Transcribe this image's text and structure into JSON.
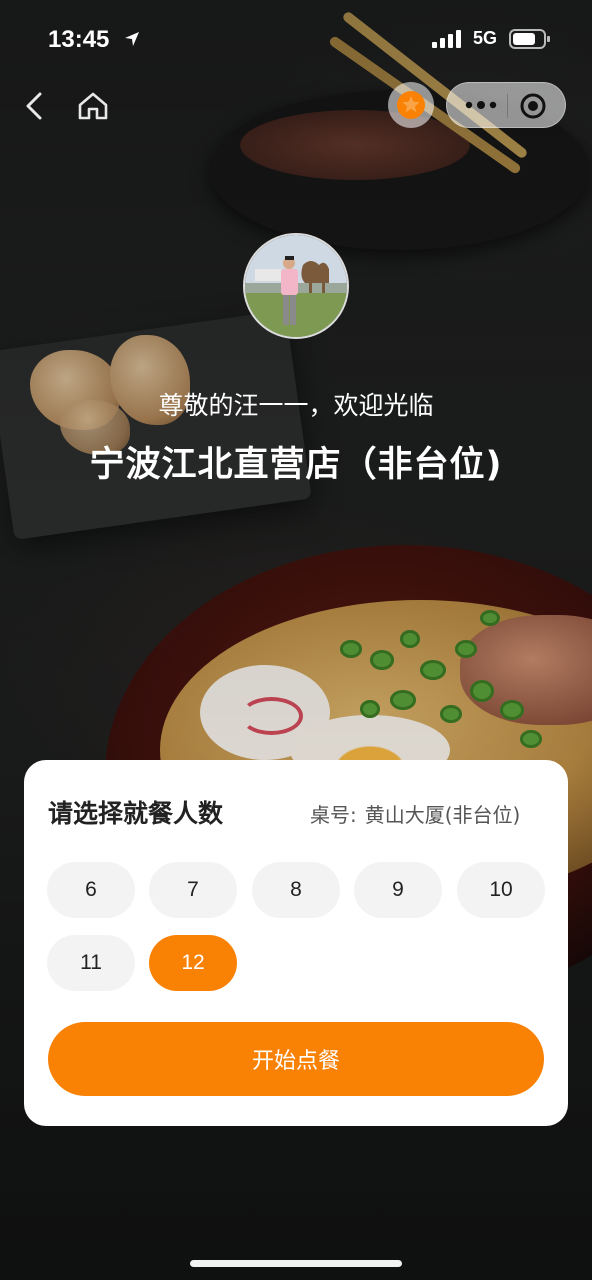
{
  "status_bar": {
    "time": "13:45",
    "network": "5G",
    "location_icon": "location-arrow-icon",
    "signal_icon": "signal-bars-icon",
    "battery_icon": "battery-icon"
  },
  "nav": {
    "back_icon": "chevron-left-icon",
    "home_icon": "home-icon",
    "favorite_icon": "star-icon",
    "more_icon": "more-dots-icon",
    "close_icon": "target-circle-icon"
  },
  "header": {
    "greeting": "尊敬的汪一一，欢迎光临",
    "store_name": "宁波江北直营店（非台位)"
  },
  "party_size": {
    "title": "请选择就餐人数",
    "table_label": "桌号:",
    "table_value": "黄山大厦(非台位)",
    "options": [
      "6",
      "7",
      "8",
      "9",
      "10",
      "11",
      "12"
    ],
    "selected": "12"
  },
  "actions": {
    "start_order": "开始点餐"
  },
  "colors": {
    "accent": "#f98205",
    "pill_bg": "#f3f3f3",
    "card_bg": "#ffffff"
  }
}
